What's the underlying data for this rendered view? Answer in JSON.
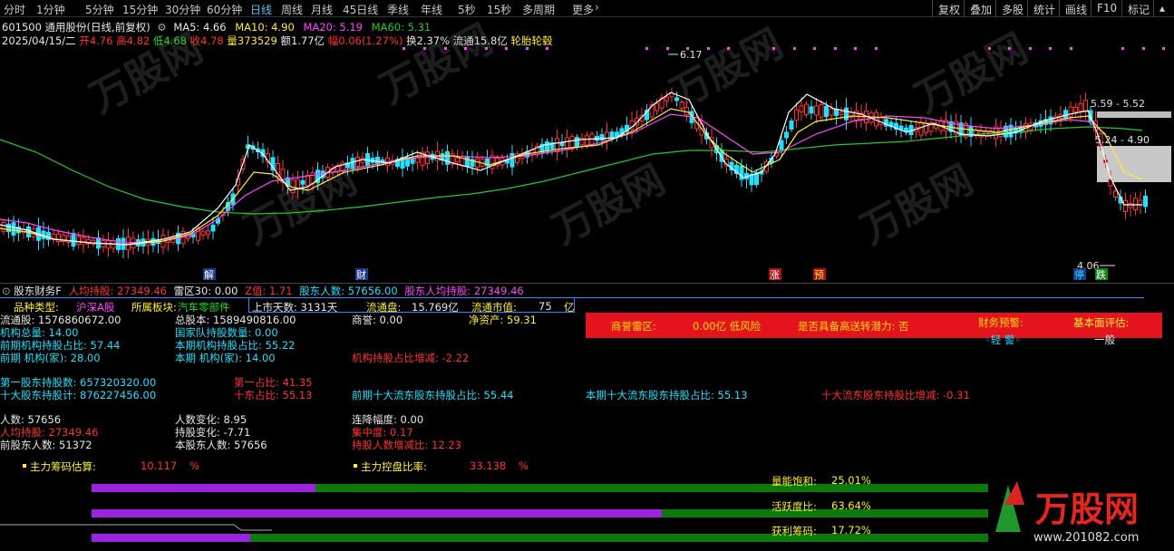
{
  "toolbar": {
    "periods": [
      "分时",
      "1分钟",
      "5分钟",
      "15分钟",
      "30分钟",
      "60分钟",
      "日线",
      "周线",
      "月线",
      "45日线",
      "季线",
      "年线",
      "5秒",
      "15秒",
      "多周期",
      "更多"
    ],
    "active_period": "日线",
    "more_icon": "chevron-right-icon",
    "right_buttons": [
      "复权",
      "叠加",
      "多股",
      "统计",
      "画线",
      "F10",
      "标记"
    ],
    "collapse_icon": "chevron-up-icon"
  },
  "header": {
    "title": "601500 通用股份(日线,前复权)",
    "ma5": "MA5: 4.66",
    "ma10": "MA10: 4.90",
    "ma20": "MA20: 5.19",
    "ma60": "MA60: 5.31",
    "date": "2025/04/15/二",
    "open": "开4.76",
    "high": "高4.82",
    "low": "低4.68",
    "close": "收4.78",
    "volume": "量373529",
    "amount": "额1.77亿",
    "change": "幅0.06(1.27%)",
    "turnover": "换2.37%",
    "float_cap": "流通15.8亿",
    "concept": "轮胎轮毂",
    "gear_icon": "gear-icon"
  },
  "chart_annotations": {
    "high_label": "6.17",
    "low_label": "4.06",
    "range_label_1": "5.59 - 5.52",
    "range_label_2": "5.24 - 4.90",
    "markers": [
      "解",
      "财",
      "涨",
      "预",
      "停",
      "跌"
    ],
    "colors": {
      "up": "#ff3232",
      "down": "#22e0ff",
      "ma5": "#ffffff",
      "ma10": "#ffee33",
      "ma20": "#ff44ff",
      "ma60": "#22cc22"
    }
  },
  "panel_header": {
    "name": "股东财务F",
    "avg_holding": "人均持股: 27349.46",
    "thunder": "雷区30: 0.00",
    "z_value": "Z值: 1.71",
    "holders": "股东人数: 57656.00",
    "holders_avg": "股东人均持股: 27349.46"
  },
  "info": {
    "variety_label": "品种类型:",
    "variety_value": "沪深A股",
    "sector_label": "所属板块:",
    "sector_value": "汽车零部件",
    "listed_days": "上市天数: 3131天",
    "float_shares_label": "流通盘:",
    "float_shares_value": "15.769亿",
    "float_mv_label": "流通市值:",
    "float_mv_value": "75",
    "float_mv_unit": "亿",
    "circ_shares": "流通股: 1576860672.00",
    "total_shares": "总股本: 1589490816.00",
    "goodwill": "商誉: 0.00",
    "net_assets": "净资产: 59.31",
    "inst_total": "机构总量: 14.00",
    "national_team": "国家队持股数量: 0.00",
    "prev_inst_ratio": "前期机构持股占比: 57.44",
    "curr_inst_ratio": "本期机构持股占比: 55.22",
    "prev_inst_count": "前期 机构(家): 28.00",
    "curr_inst_count": "本期 机构(家): 14.00",
    "inst_change": "机构持股占比增减: -2.22",
    "top1_holding": "第一股东持股数: 657320320.00",
    "top1_ratio": "第一占比: 41.35",
    "top10_total": "十大股东持股计: 876227456.00",
    "top10_ratio": "十东占比: 55.13",
    "prev_top10_float": "前期十大流东股东持股占比: 55.44",
    "curr_top10_float": "本期十大流东股东持股占比: 55.13",
    "top10_float_change": "十大流东股东持股比增减: -0.31",
    "people": "人数: 57656",
    "people_change": "人数变化: 8.95",
    "consec_decline": "连降幅度: 0.00",
    "avg_hold": "人均持股: 27349.46",
    "hold_change": "持股变化: -7.71",
    "concentration": "集中度: 0.17",
    "prev_people": "前股东人数: 51372",
    "curr_people": "本股东人数: 57656",
    "avg_hold_change": "持股人数增减比: 12.23",
    "main_chip_label": "主力筹码估算:",
    "main_chip_value": "10.117",
    "main_chip_unit": "%",
    "main_control_label": "主力控盘比率:",
    "main_control_value": "33.138",
    "main_control_unit": "%"
  },
  "alert": {
    "goodwill_zone": "商誉雷区:",
    "goodwill_value": "0.00亿 低风险",
    "high_transfer": "是否具备高送转潜力: 否",
    "finance_warning": "财务预警:",
    "warning_level": "◦轻 警◦",
    "fundamental_label": "基本面评估:",
    "fundamental_value": "一般"
  },
  "bars": {
    "energy_label": "量能饱和:",
    "energy_value": "25.01%",
    "energy_fraction": 0.2501,
    "activity_label": "活跃度比:",
    "activity_value": "63.64%",
    "activity_fraction": 0.6364,
    "profit_label": "获利筹码:",
    "profit_value": "17.72%",
    "profit_fraction": 0.1772
  },
  "watermark": {
    "brand": "万股网",
    "url": "www.201082.com"
  }
}
